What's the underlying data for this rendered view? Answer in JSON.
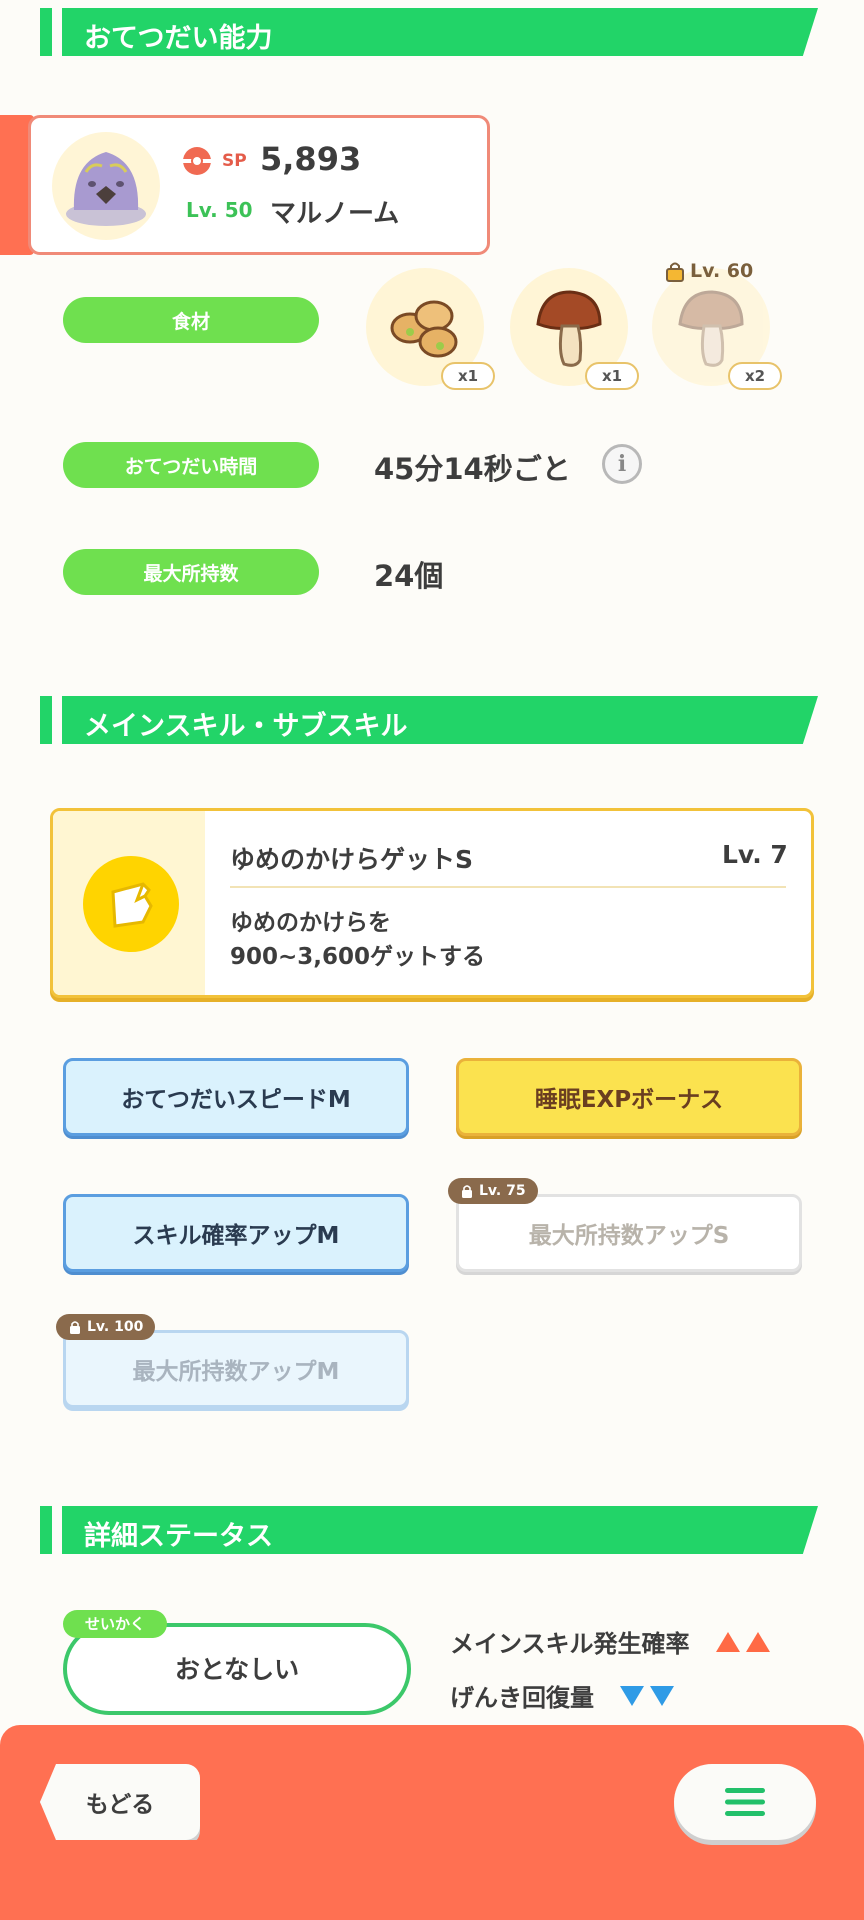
{
  "sections": {
    "helper": "おてつだい能力",
    "skills": "メインスキル・サブスキル",
    "details": "詳細ステータス"
  },
  "pokemon": {
    "sp_label": "SP",
    "sp_value": "5,893",
    "level": "Lv. 50",
    "name": "マルノーム"
  },
  "ingredients": {
    "label": "食材",
    "items": [
      {
        "icon": "soybeans-icon",
        "qty": "x1"
      },
      {
        "icon": "mushroom-icon",
        "qty": "x1"
      },
      {
        "icon": "mushroom-icon",
        "qty": "x2",
        "locked_level": "Lv. 60"
      }
    ]
  },
  "help_time": {
    "label": "おてつだい時間",
    "value": "45分14秒ごと"
  },
  "max_carry": {
    "label": "最大所持数",
    "value": "24個"
  },
  "main_skill": {
    "name": "ゆめのかけらゲットS",
    "level": "Lv. 7",
    "desc_line1": "ゆめのかけらを",
    "desc_line2": "900~3,600ゲットする"
  },
  "sub_skills": [
    {
      "label": "おてつだいスピードM",
      "style": "blue"
    },
    {
      "label": "睡眠EXPボーナス",
      "style": "gold"
    },
    {
      "label": "スキル確率アップM",
      "style": "blue"
    },
    {
      "label": "最大所持数アップS",
      "style": "locked",
      "lock": "Lv. 75"
    },
    {
      "label": "最大所持数アップM",
      "style": "locked",
      "lock": "Lv. 100"
    }
  ],
  "nature": {
    "tag": "せいかく",
    "name": "おとなしい",
    "up_label": "メインスキル発生確率",
    "down_label": "げんき回復量",
    "up_color": "#ff6a45",
    "down_color": "#2f9be6"
  },
  "nav": {
    "back": "もどる",
    "menu_icon": "hamburger-menu-icon"
  }
}
